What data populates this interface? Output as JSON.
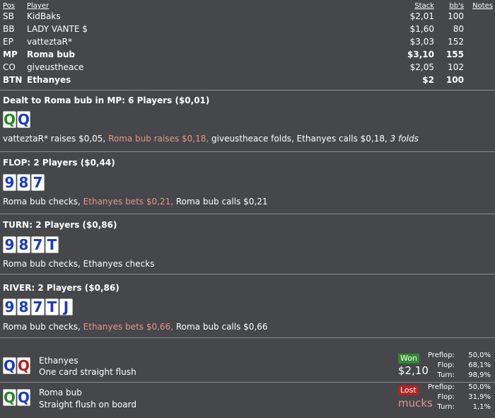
{
  "players": {
    "headers": {
      "pos": "Pos",
      "player": "Player",
      "stack": "Stack",
      "bbs": "bb's",
      "notes": "Notes"
    },
    "rows": [
      {
        "pos": "SB",
        "name": "KidBaks",
        "stack": "$2,01",
        "bb": "100",
        "bold": false
      },
      {
        "pos": "BB",
        "name": "LADY VANTE $",
        "stack": "$1,60",
        "bb": "80",
        "bold": false
      },
      {
        "pos": "EP",
        "name": "vatteztaR*",
        "stack": "$3,03",
        "bb": "152",
        "bold": false
      },
      {
        "pos": "MP",
        "name": "Roma bub",
        "stack": "$3,10",
        "bb": "155",
        "bold": true
      },
      {
        "pos": "CO",
        "name": "giveustheace",
        "stack": "$2,05",
        "bb": "102",
        "bold": false
      },
      {
        "pos": "BTN",
        "name": "Ethanyes",
        "stack": "$2",
        "bb": "100",
        "bold": true
      }
    ]
  },
  "preflop": {
    "title": "Dealt to Roma bub in MP: 6 Players ($0,01)",
    "cards": [
      {
        "rank": "Q",
        "color": "green"
      },
      {
        "rank": "Q",
        "color": "blue"
      }
    ],
    "a1": "vatteztaR* raises $0,05, ",
    "a2": "Roma bub raises $0,18,",
    "a3": " giveustheace folds, Ethanyes calls $0,18, ",
    "a4": "3 folds"
  },
  "flop": {
    "title": "FLOP: 2 Players ($0,44)",
    "cards": [
      "9",
      "8",
      "7"
    ],
    "a1": "Roma bub checks, ",
    "a2": "Ethanyes bets $0,21,",
    "a3": " Roma bub calls $0,21"
  },
  "turn": {
    "title": "TURN: 2 Players ($0,86)",
    "cards": [
      "9",
      "8",
      "7",
      "T"
    ],
    "a1": "Roma bub checks, Ethanyes checks"
  },
  "river": {
    "title": "RIVER: 2 Players ($0,86)",
    "cards": [
      "9",
      "8",
      "7",
      "T",
      "J"
    ],
    "a1": "Roma bub checks, ",
    "a2": "Ethanyes bets $0,66,",
    "a3": " Roma bub calls $0,66"
  },
  "results": [
    {
      "name": "Ethanyes",
      "desc": "One card straight flush",
      "cards": [
        {
          "rank": "Q",
          "color": "blue"
        },
        {
          "rank": "Q",
          "color": "red"
        }
      ],
      "badge": "Won",
      "amount": "$2,10",
      "eq": [
        {
          "label": "Preflop:",
          "value": "50,0%"
        },
        {
          "label": "Flop:",
          "value": "68,1%"
        },
        {
          "label": "Turn:",
          "value": "98,9%"
        }
      ]
    },
    {
      "name": "Roma bub",
      "desc": "Straight flush on board",
      "cards": [
        {
          "rank": "Q",
          "color": "green"
        },
        {
          "rank": "Q",
          "color": "blue"
        }
      ],
      "badge": "Lost",
      "amount": "mucks",
      "eq": [
        {
          "label": "Preflop:",
          "value": "50,0%"
        },
        {
          "label": "Flop:",
          "value": "31,9%"
        },
        {
          "label": "Turn:",
          "value": "1,1%"
        }
      ]
    }
  ]
}
